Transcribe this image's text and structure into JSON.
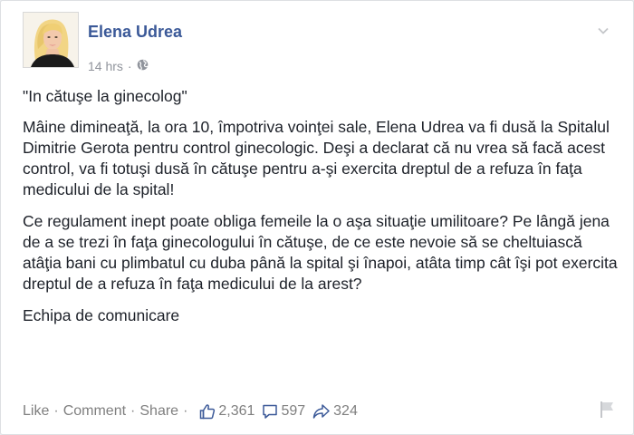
{
  "post": {
    "author": "Elena Udrea",
    "time": "14 hrs",
    "meta_separator": "·",
    "audience_icon": "globe-icon",
    "quote_title": "\"In cătuşe la ginecolog\"",
    "paragraphs": [
      "Mâine dimineaţă, la ora 10, împotriva voinţei sale, Elena Udrea va fi dusă la Spitalul Dimitrie Gerota pentru control ginecologic. Deşi a declarat că nu vrea să facă acest control, va fi totuşi dusă în cătuşe pentru a-şi exercita dreptul de a refuza în faţa medicului de la spital!",
      "Ce regulament inept poate obliga femeile la o aşa situaţie umilitoare? Pe lângă jena de a se trezi în faţa ginecologului în cătuşe, de ce este nevoie să se cheltuiască atâţia bani cu plimbatul cu duba până la spital şi înapoi, atâta timp cât îşi pot exercita dreptul de a refuza în faţa medicului de la arest?",
      "Echipa de comunicare"
    ]
  },
  "actions": {
    "like": "Like",
    "comment": "Comment",
    "share": "Share",
    "separator": "·",
    "likes_count": "2,361",
    "comments_count": "597",
    "shares_count": "324"
  },
  "colors": {
    "name": "#3b5998",
    "meta": "#90949c",
    "text": "#1d2129",
    "actions": "#7f7f7f"
  }
}
